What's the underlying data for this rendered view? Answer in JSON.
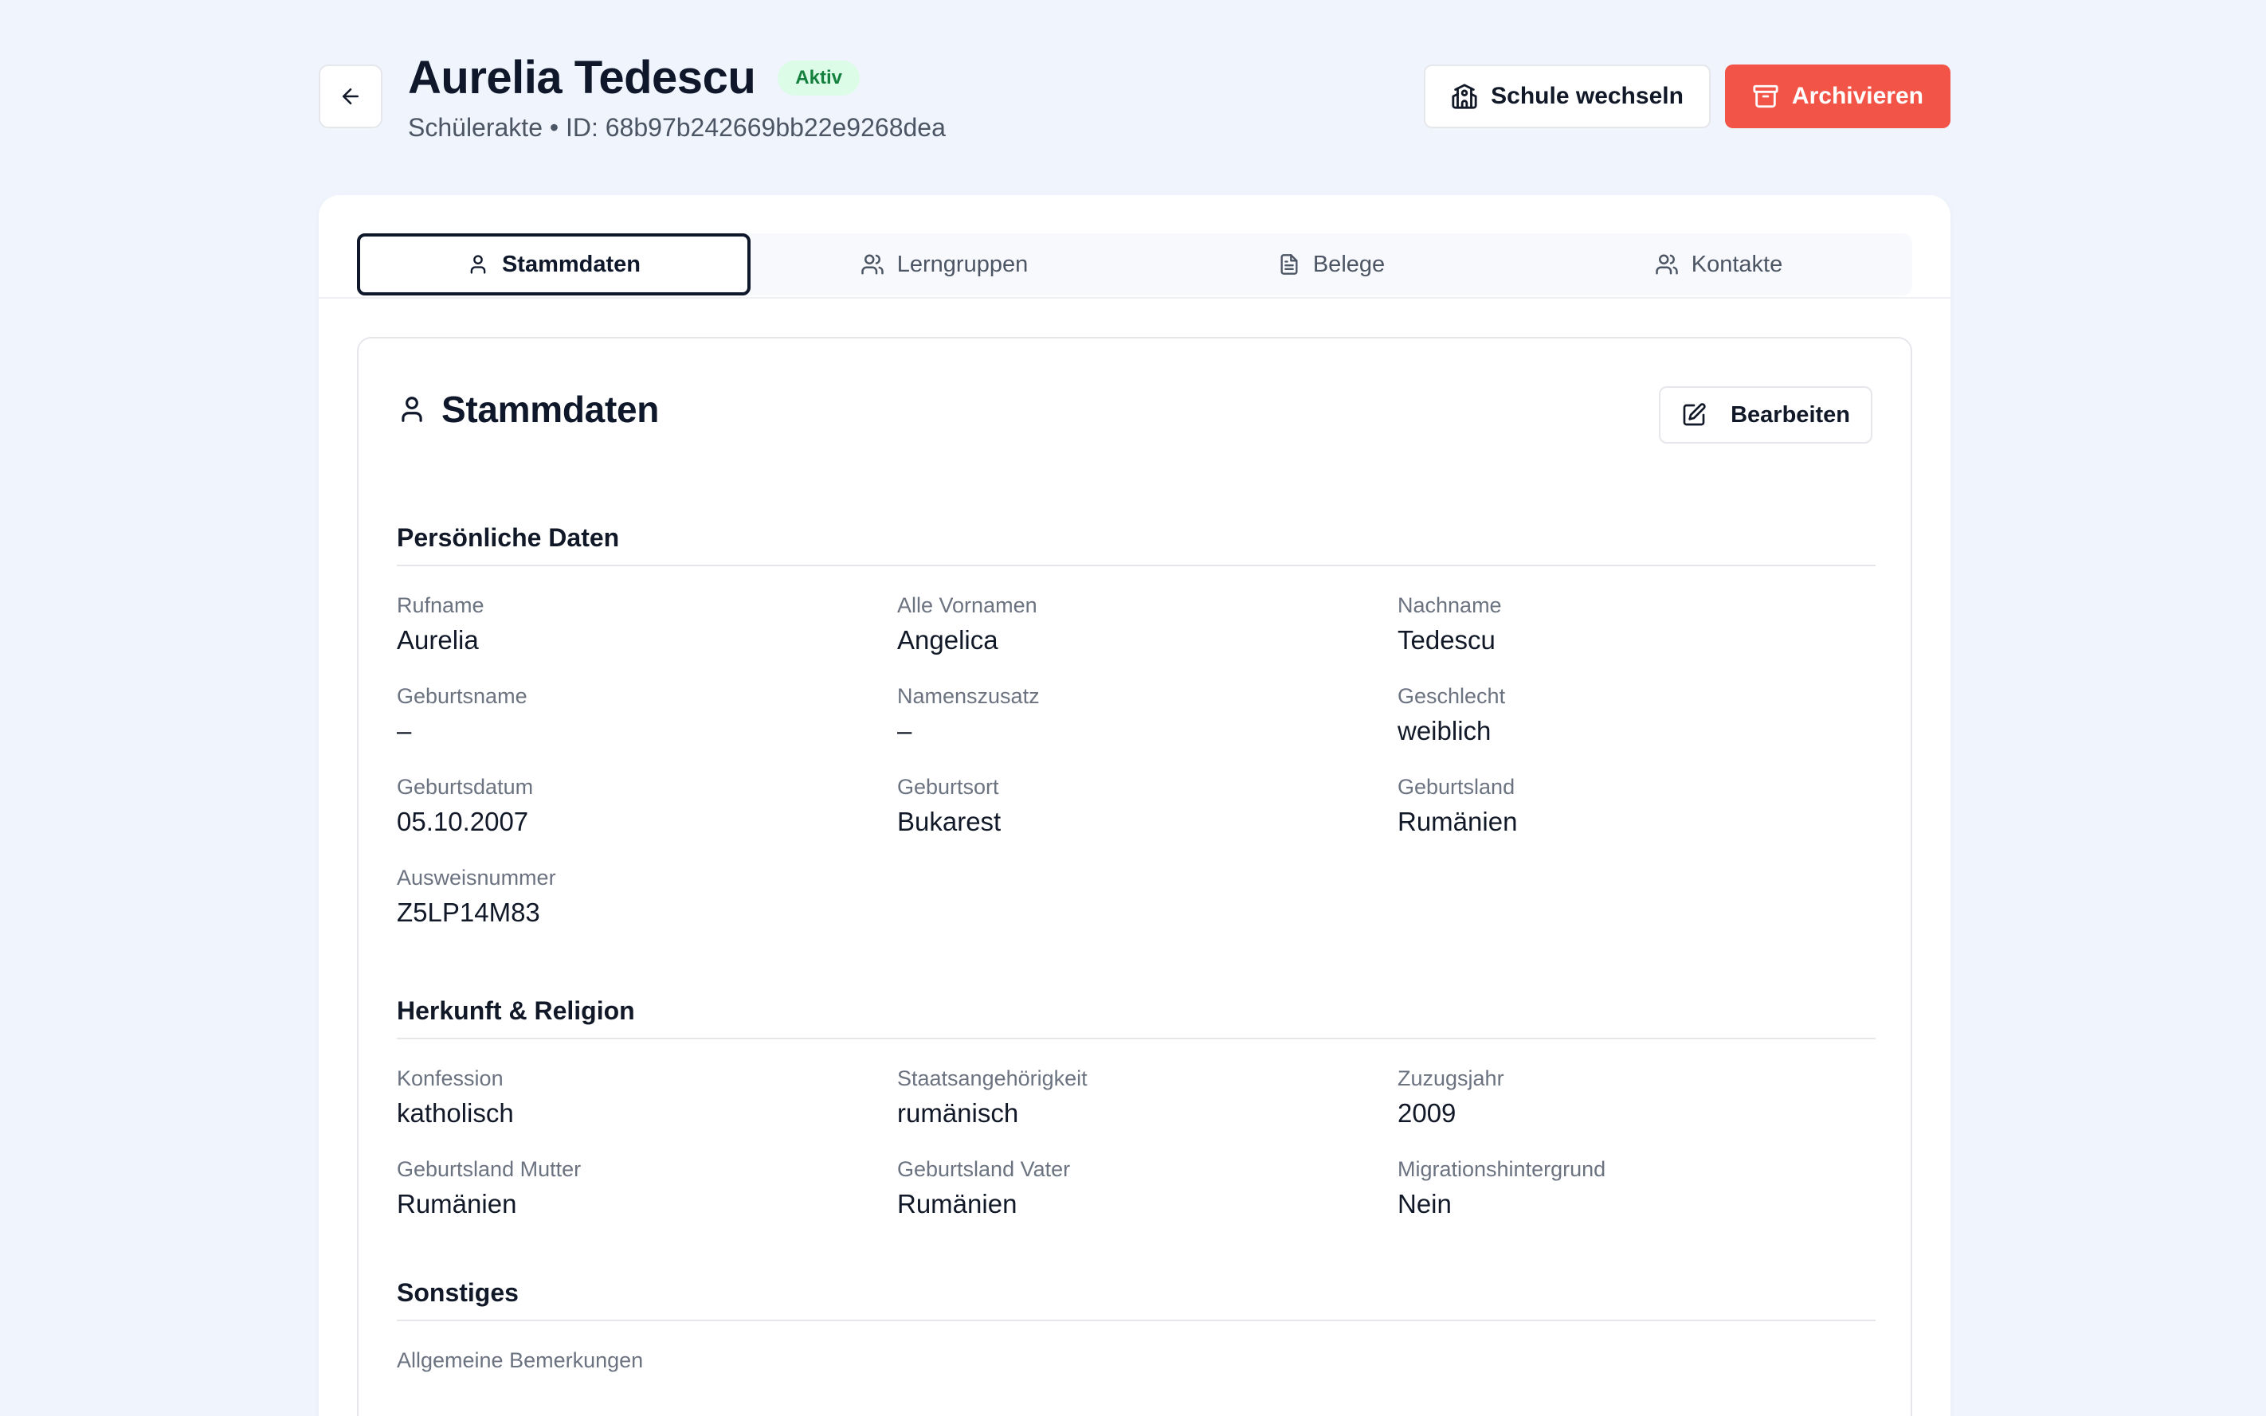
{
  "header": {
    "title": "Aurelia Tedescu",
    "status": "Aktiv",
    "subtitle": "Schülerakte • ID: 68b97b242669bb22e9268dea",
    "actions": {
      "switch_school": "Schule wechseln",
      "archive": "Archivieren"
    }
  },
  "tabs": [
    {
      "label": "Stammdaten",
      "icon": "user-icon",
      "active": true
    },
    {
      "label": "Lerngruppen",
      "icon": "users-icon",
      "active": false
    },
    {
      "label": "Belege",
      "icon": "document-icon",
      "active": false
    },
    {
      "label": "Kontakte",
      "icon": "users-icon",
      "active": false
    }
  ],
  "section": {
    "title": "Stammdaten",
    "edit_label": "Bearbeiten"
  },
  "groups": [
    {
      "title": "Persönliche Daten",
      "fields": [
        {
          "label": "Rufname",
          "value": "Aurelia"
        },
        {
          "label": "Alle Vornamen",
          "value": "Angelica"
        },
        {
          "label": "Nachname",
          "value": "Tedescu"
        },
        {
          "label": "Geburtsname",
          "value": "–"
        },
        {
          "label": "Namenszusatz",
          "value": "–"
        },
        {
          "label": "Geschlecht",
          "value": "weiblich"
        },
        {
          "label": "Geburtsdatum",
          "value": "05.10.2007"
        },
        {
          "label": "Geburtsort",
          "value": "Bukarest"
        },
        {
          "label": "Geburtsland",
          "value": "Rumänien"
        },
        {
          "label": "Ausweisnummer",
          "value": "Z5LP14M83"
        }
      ]
    },
    {
      "title": "Herkunft & Religion",
      "fields": [
        {
          "label": "Konfession",
          "value": "katholisch"
        },
        {
          "label": "Staatsangehörigkeit",
          "value": "rumänisch"
        },
        {
          "label": "Zuzugsjahr",
          "value": "2009"
        },
        {
          "label": "Geburtsland Mutter",
          "value": "Rumänien"
        },
        {
          "label": "Geburtsland Vater",
          "value": "Rumänien"
        },
        {
          "label": "Migrationshintergrund",
          "value": "Nein"
        }
      ]
    },
    {
      "title": "Sonstiges",
      "fields": [
        {
          "label": "Allgemeine Bemerkungen",
          "value": ""
        }
      ]
    }
  ],
  "colors": {
    "background": "#f0f4fd",
    "danger": "#f25448",
    "badge_bg": "#dcfce7",
    "badge_text": "#15803d",
    "active_tab_border": "#0f172a"
  }
}
